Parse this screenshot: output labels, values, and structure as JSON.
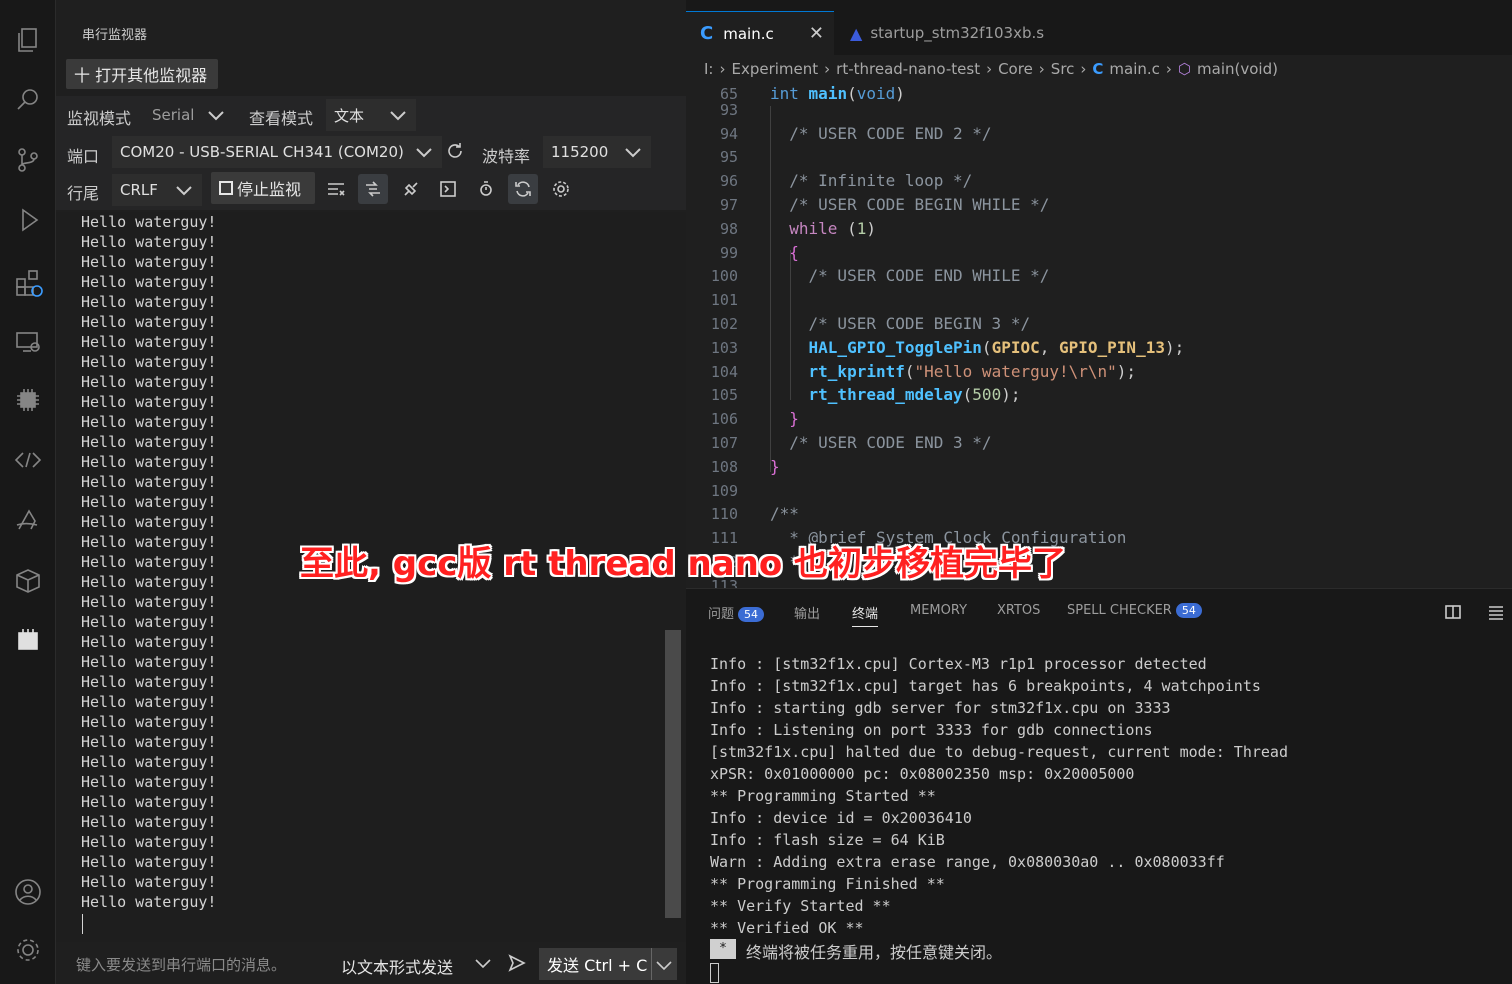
{
  "serial_monitor": {
    "title": "串行监视器",
    "open_other_button": "十 打开其他监视器",
    "monitor_mode_label": "监视模式",
    "monitor_mode_value": "Serial",
    "view_mode_label": "查看模式",
    "view_mode_value": "文本",
    "port_label": "端口",
    "port_value": "COM20 - USB-SERIAL CH341 (COM20)",
    "baud_label": "波特率",
    "baud_value": "115200",
    "line_ending_label": "行尾",
    "line_ending_value": "CRLF",
    "stop_button": "停止监视",
    "output_lines": [
      "Hello waterguy!",
      "Hello waterguy!",
      "Hello waterguy!",
      "Hello waterguy!",
      "Hello waterguy!",
      "Hello waterguy!",
      "Hello waterguy!",
      "Hello waterguy!",
      "Hello waterguy!",
      "Hello waterguy!",
      "Hello waterguy!",
      "Hello waterguy!",
      "Hello waterguy!",
      "Hello waterguy!",
      "Hello waterguy!",
      "Hello waterguy!",
      "Hello waterguy!",
      "Hello waterguy!",
      "Hello waterguy!",
      "Hello waterguy!",
      "Hello waterguy!",
      "Hello waterguy!",
      "Hello waterguy!",
      "Hello waterguy!",
      "Hello waterguy!",
      "Hello waterguy!",
      "Hello waterguy!",
      "Hello waterguy!",
      "Hello waterguy!",
      "Hello waterguy!",
      "Hello waterguy!",
      "Hello waterguy!",
      "Hello waterguy!",
      "Hello waterguy!",
      "Hello waterguy!"
    ],
    "send_placeholder": "键入要发送到串行端口的消息。",
    "send_mode": "以文本形式发送",
    "send_button": "发送 Ctrl + C"
  },
  "editor": {
    "tabs": [
      {
        "label": "main.c",
        "icon": "c-file-icon"
      },
      {
        "label": "startup_stm32f103xb.s",
        "icon": "asm-file-icon"
      }
    ],
    "breadcrumb": [
      "I:",
      "Experiment",
      "rt-thread-nano-test",
      "Core",
      "Src",
      "main.c",
      "main(void)"
    ],
    "lines": [
      {
        "n": "65",
        "t": "int main(void)"
      },
      {
        "n": "93",
        "t": ""
      },
      {
        "n": "94",
        "t": "  /* USER CODE END 2 */"
      },
      {
        "n": "95",
        "t": ""
      },
      {
        "n": "96",
        "t": "  /* Infinite loop */"
      },
      {
        "n": "97",
        "t": "  /* USER CODE BEGIN WHILE */"
      },
      {
        "n": "98",
        "t": "  while (1)"
      },
      {
        "n": "99",
        "t": "  {"
      },
      {
        "n": "100",
        "t": "    /* USER CODE END WHILE */"
      },
      {
        "n": "101",
        "t": ""
      },
      {
        "n": "102",
        "t": "    /* USER CODE BEGIN 3 */"
      },
      {
        "n": "103",
        "t": "    HAL_GPIO_TogglePin(GPIOC, GPIO_PIN_13);"
      },
      {
        "n": "104",
        "t": "    rt_kprintf(\"Hello waterguy!\\r\\n\");"
      },
      {
        "n": "105",
        "t": "    rt_thread_mdelay(500);"
      },
      {
        "n": "106",
        "t": "  }"
      },
      {
        "n": "107",
        "t": "  /* USER CODE END 3 */"
      },
      {
        "n": "108",
        "t": "}"
      },
      {
        "n": "109",
        "t": ""
      },
      {
        "n": "110",
        "t": "/**"
      },
      {
        "n": "111",
        "t": "  * @brief System Clock Configuration"
      },
      {
        "n": "112",
        "t": "  */"
      },
      {
        "n": "113",
        "t": ""
      }
    ]
  },
  "panel": {
    "tabs": [
      {
        "label": "问题",
        "badge": "54"
      },
      {
        "label": "输出",
        "badge": ""
      },
      {
        "label": "终端",
        "badge": ""
      },
      {
        "label": "MEMORY",
        "badge": ""
      },
      {
        "label": "XRTOS",
        "badge": ""
      },
      {
        "label": "SPELL CHECKER",
        "badge": "54"
      }
    ],
    "terminal_lines": [
      "Info : [stm32f1x.cpu] Cortex-M3 r1p1 processor detected",
      "Info : [stm32f1x.cpu] target has 6 breakpoints, 4 watchpoints",
      "Info : starting gdb server for stm32f1x.cpu on 3333",
      "Info : Listening on port 3333 for gdb connections",
      "[stm32f1x.cpu] halted due to debug-request, current mode: Thread",
      "xPSR: 0x01000000 pc: 0x08002350 msp: 0x20005000",
      "** Programming Started **",
      "Info : device id = 0x20036410",
      "Info : flash size = 64 KiB",
      "Warn : Adding extra erase range, 0x080030a0 .. 0x080033ff",
      "** Programming Finished **",
      "** Verify Started **",
      "** Verified OK **"
    ],
    "terminal_star": "*",
    "terminal_message": "终端将被任务重用，按任意键关闭。"
  },
  "overlay_caption": "至此, gcc版 rt thread nano 也初步移植完毕了",
  "colors": {
    "accent": "#0078d4",
    "badge": "#3b6cd4",
    "caption": "#ff2020"
  }
}
